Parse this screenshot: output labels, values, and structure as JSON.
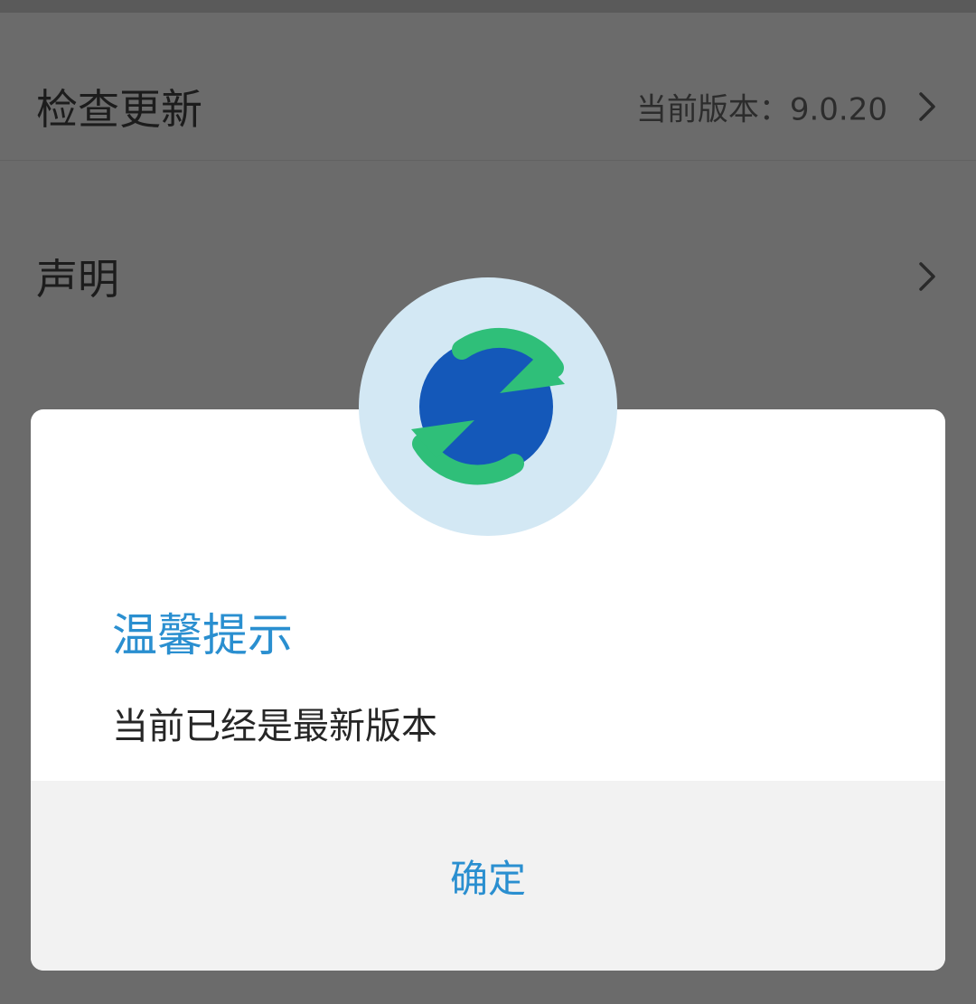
{
  "settings": {
    "check_update": {
      "title": "检查更新",
      "version_text": "当前版本：9.0.20"
    },
    "statement": {
      "title": "声明"
    }
  },
  "dialog": {
    "title": "温馨提示",
    "message": "当前已经是最新版本",
    "confirm_label": "确定",
    "icon": "update-sync-icon"
  },
  "colors": {
    "overlay": "#6b6b6b",
    "accent": "#2a8fd0",
    "icon_blue": "#1458b9",
    "icon_green": "#2fbf79",
    "icon_bg": "#d3e8f4",
    "footer_bg": "#f2f2f2"
  }
}
